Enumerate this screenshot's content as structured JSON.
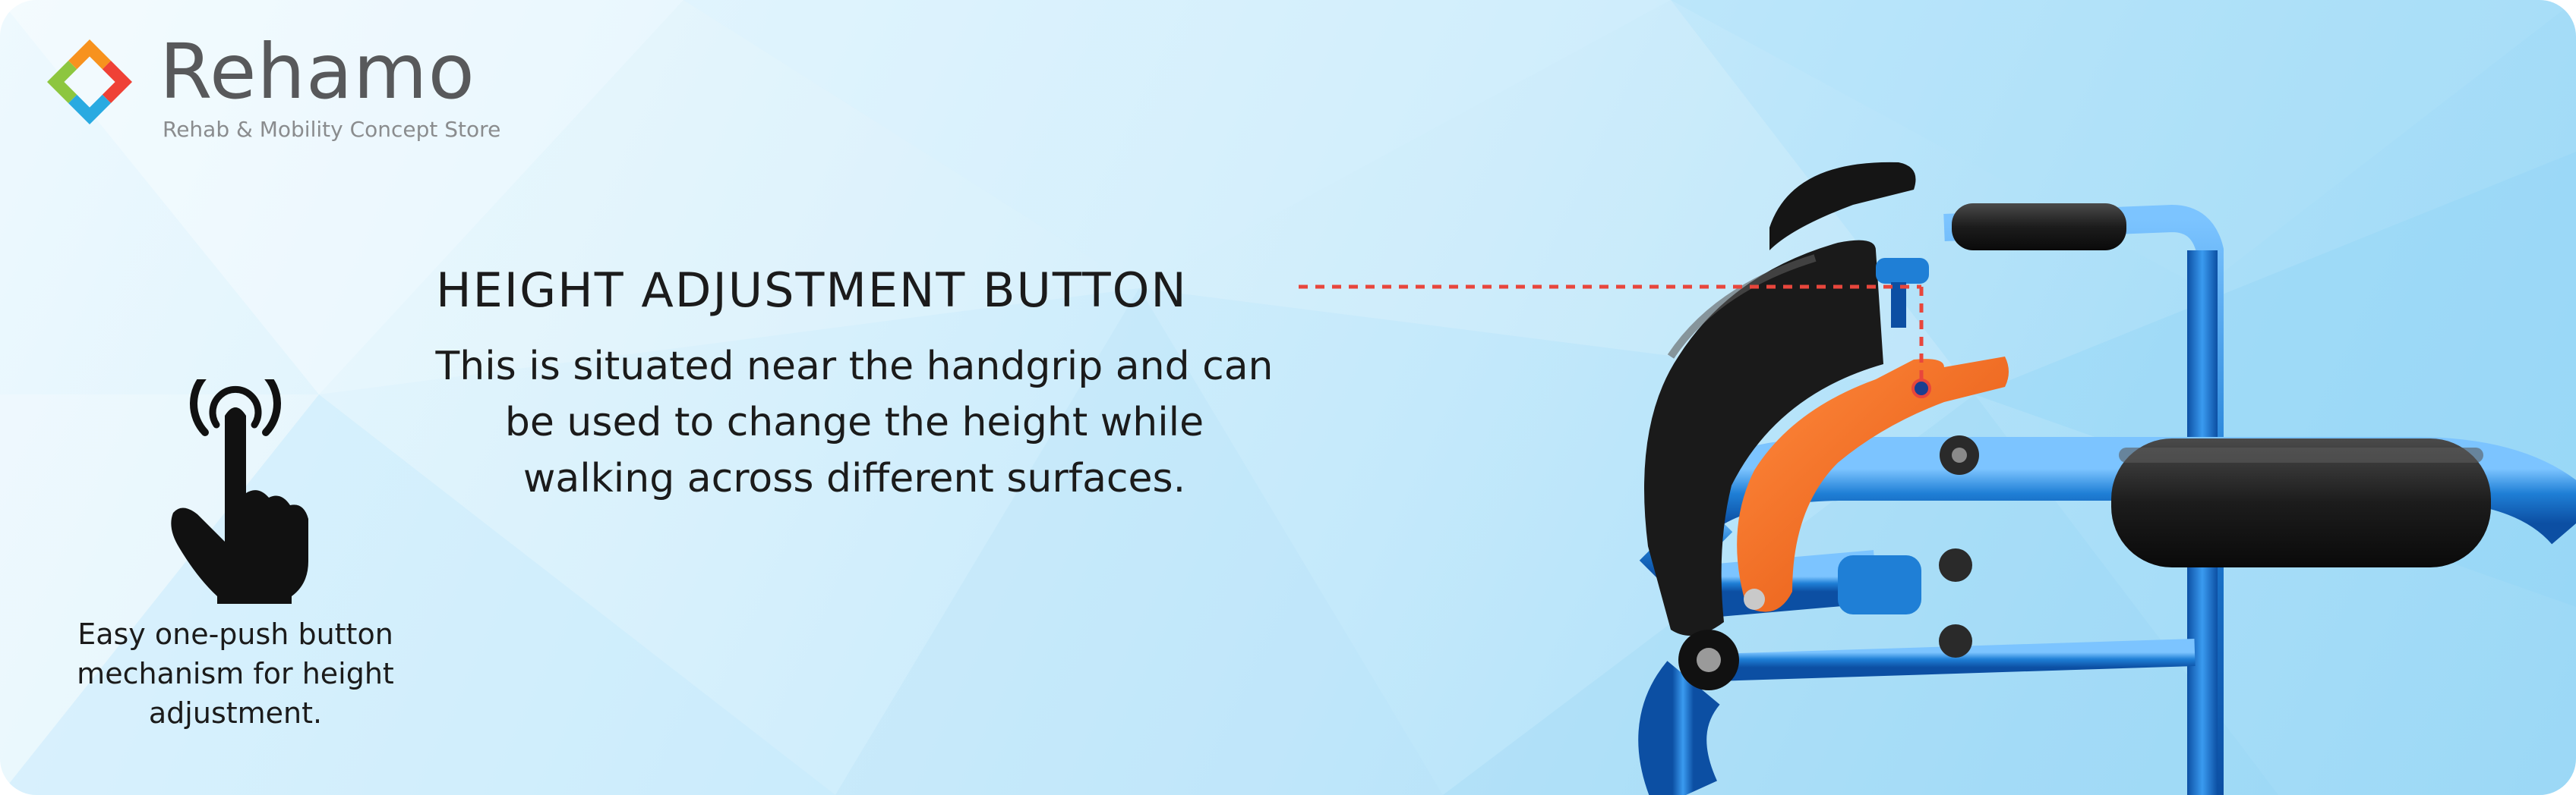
{
  "brand": {
    "name": "Rehamo",
    "tagline": "Rehab & Mobility Concept Store",
    "colors": {
      "orange": "#f7921e",
      "green": "#8dc63f",
      "blue": "#29aae1",
      "red": "#ef4136",
      "text": "#58595b"
    }
  },
  "feature": {
    "title": "HEIGHT ADJUSTMENT BUTTON",
    "description": "This is situated near the handgrip and can be used to change the height while walking across different surfaces.",
    "callout_color": "#e8463c"
  },
  "highlight": {
    "icon": "touch-hand-icon",
    "caption": "Easy one-push button mechanism for height adjustment."
  },
  "product": {
    "image": "walker-handgrip-photo",
    "frame_color": "#1f7fd6",
    "button_color": "#f26522"
  }
}
